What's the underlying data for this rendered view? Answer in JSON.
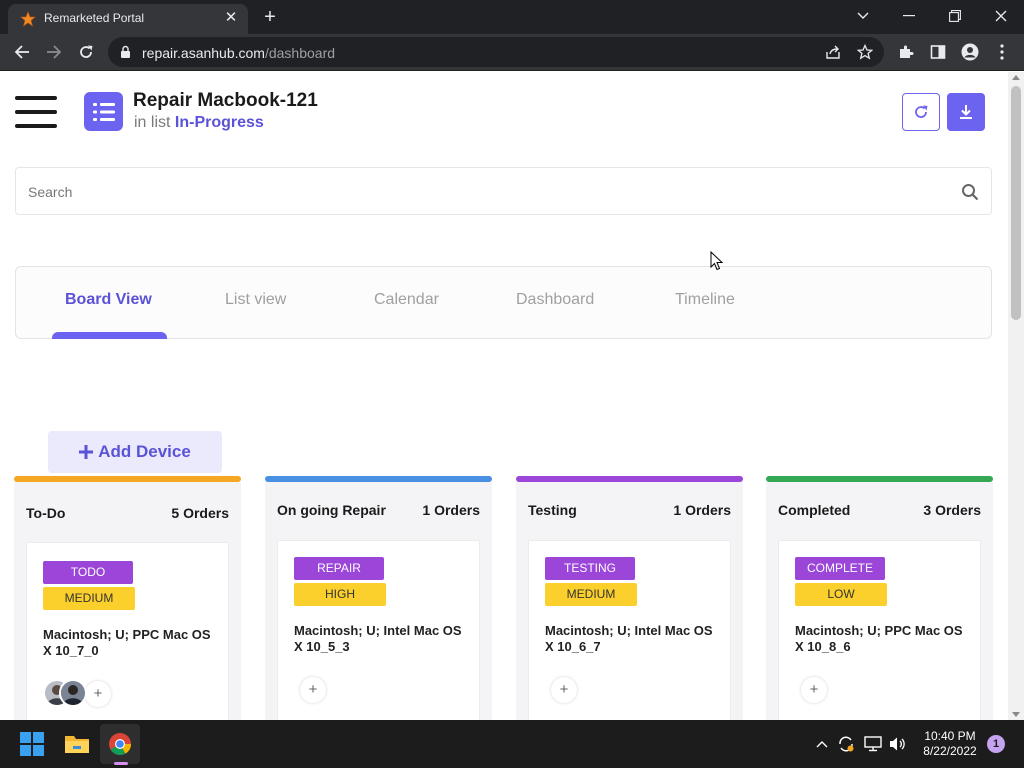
{
  "browser": {
    "tab_title": "Remarketed Portal",
    "url_host": "repair.asanhub.com",
    "url_path": "/dashboard"
  },
  "header": {
    "title": "Repair Macbook-121",
    "list_prefix": "in list",
    "list_name": "In-Progress"
  },
  "search": {
    "placeholder": "Search"
  },
  "view_tabs": [
    {
      "label": "Board View",
      "active": true
    },
    {
      "label": "List view",
      "active": false
    },
    {
      "label": "Calendar",
      "active": false
    },
    {
      "label": "Dashboard",
      "active": false
    },
    {
      "label": "Timeline",
      "active": false
    }
  ],
  "add_device": {
    "label": "Add Device"
  },
  "columns": [
    {
      "title": "To-Do",
      "count": "5 Orders",
      "color": "#f5a623",
      "card": {
        "status": "TODO",
        "priority": "MEDIUM",
        "description": "Macintosh; U; PPC Mac OS X 10_7_0"
      }
    },
    {
      "title": "On going Repair",
      "count": "1 Orders",
      "color": "#4a90e2",
      "card": {
        "status": "REPAIR",
        "priority": "HIGH",
        "description": "Macintosh; U; Intel Mac OS X 10_5_3"
      }
    },
    {
      "title": "Testing",
      "count": "1 Orders",
      "color": "#9b45d9",
      "card": {
        "status": "TESTING",
        "priority": "MEDIUM",
        "description": "Macintosh; U; Intel Mac OS X 10_6_7"
      }
    },
    {
      "title": "Completed",
      "count": "3 Orders",
      "color": "#34a853",
      "card": {
        "status": "COMPLETE",
        "priority": "LOW",
        "description": "Macintosh; U; PPC Mac OS X 10_8_6"
      }
    }
  ],
  "taskbar": {
    "time": "10:40 PM",
    "date": "8/22/2022",
    "notifications": "1"
  },
  "colors": {
    "accent": "#6c63f0",
    "status_tag": "#9b45d9",
    "priority_tag": "#fbcf2c"
  }
}
